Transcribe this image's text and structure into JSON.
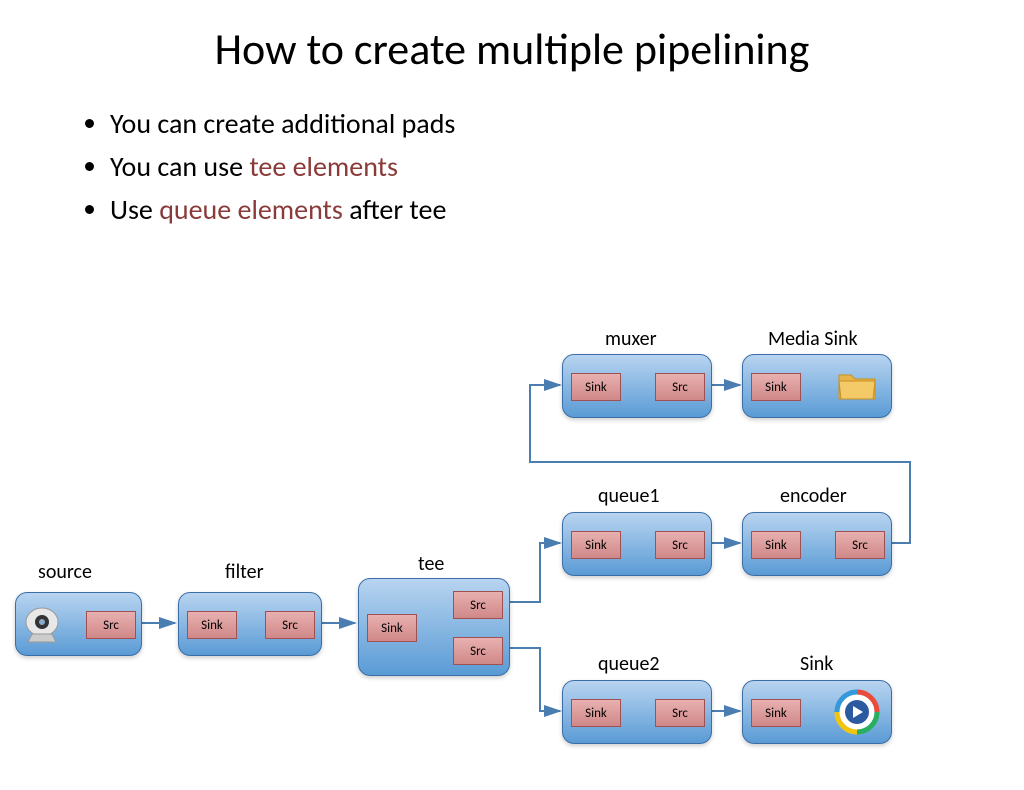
{
  "title": "How to create multiple pipelining",
  "bullets": {
    "b1": "You can create additional pads",
    "b2_a": "You can use ",
    "b2_b": "tee elements",
    "b3_a": "Use ",
    "b3_b": "queue elements",
    "b3_c": " after tee"
  },
  "labels": {
    "source": "source",
    "filter": "filter",
    "tee": "tee",
    "queue1": "queue1",
    "encoder": "encoder",
    "queue2": "queue2",
    "sink": "Sink",
    "muxer": "muxer",
    "mediasink": "Media Sink"
  },
  "pads": {
    "sink": "Sink",
    "src": "Src"
  }
}
